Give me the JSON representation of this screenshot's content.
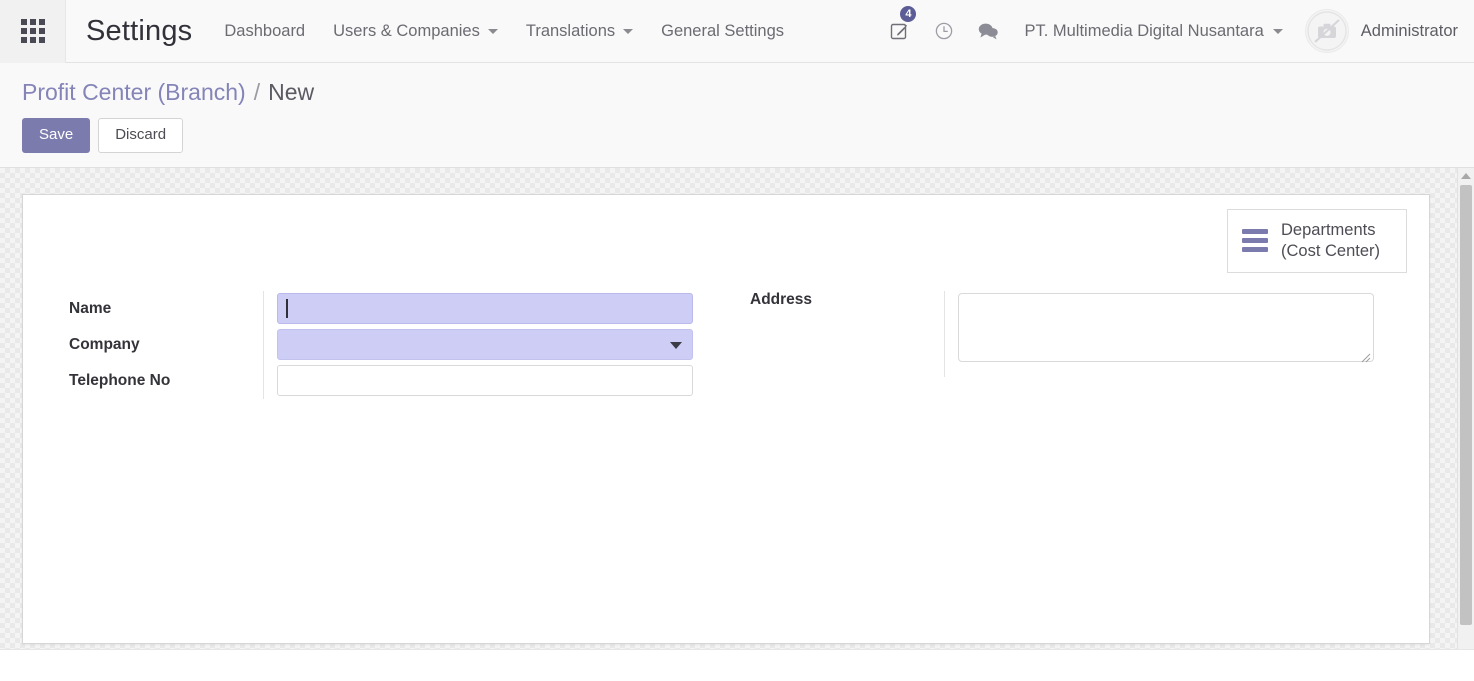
{
  "navbar": {
    "apps_icon": "apps-grid-icon",
    "brand": "Settings",
    "menu": [
      {
        "label": "Dashboard",
        "has_caret": false
      },
      {
        "label": "Users & Companies",
        "has_caret": true
      },
      {
        "label": "Translations",
        "has_caret": true
      },
      {
        "label": "General Settings",
        "has_caret": false
      }
    ],
    "systray": {
      "activities_icon": "pencil-note-icon",
      "activities_badge": "4",
      "clock_icon": "clock-icon",
      "messages_icon": "chat-bubble-icon"
    },
    "company": "PT. Multimedia Digital Nusantara",
    "avatar_icon": "no-camera-avatar-icon",
    "username": "Administrator"
  },
  "controlpanel": {
    "breadcrumb_parent": "Profit Center (Branch)",
    "breadcrumb_separator": "/",
    "breadcrumb_current": "New",
    "save_label": "Save",
    "discard_label": "Discard"
  },
  "sheet": {
    "smart_button": {
      "icon": "list-bars-icon",
      "line1": "Departments",
      "line2": "(Cost Center)"
    },
    "fields": {
      "name": {
        "label": "Name",
        "value": "",
        "placeholder": ""
      },
      "company": {
        "label": "Company",
        "value": "",
        "placeholder": ""
      },
      "telephone": {
        "label": "Telephone No",
        "value": "",
        "placeholder": ""
      },
      "address": {
        "label": "Address",
        "value": "",
        "placeholder": ""
      }
    }
  },
  "colors": {
    "accent_purple": "#7c7bad",
    "required_field": "#cdcdf5",
    "breadcrumb_link": "#8484b8",
    "badge": "#5c5c96"
  }
}
